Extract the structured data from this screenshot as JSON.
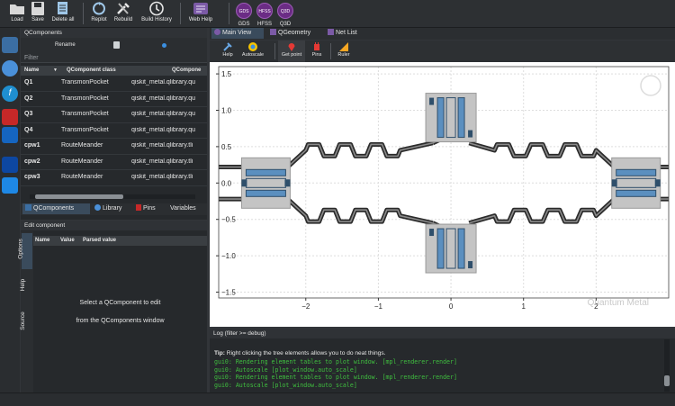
{
  "toolbar": {
    "buttons": [
      {
        "label": "Load",
        "icon": "folder-icon"
      },
      {
        "label": "Save",
        "icon": "save-icon"
      },
      {
        "label": "Delete all",
        "icon": "delete-all-icon"
      },
      {
        "label": "Replot",
        "icon": "replot-icon"
      },
      {
        "label": "Rebuild",
        "icon": "rebuild-icon"
      },
      {
        "label": "Build History",
        "icon": "build-history-icon"
      },
      {
        "label": "Web Help",
        "icon": "web-help-icon"
      }
    ],
    "gds_buttons": [
      {
        "badge": "GDS",
        "label": "GDS"
      },
      {
        "badge": "HFSS",
        "label": "HFSS"
      },
      {
        "badge": "Q3D",
        "label": "Q3D"
      }
    ]
  },
  "qcomponents": {
    "title": "QComponents",
    "rename_label": "Rename",
    "filter_placeholder": "Filter",
    "columns": [
      "Name",
      "QComponent class",
      "QCompone"
    ],
    "rows": [
      {
        "name": "Q1",
        "cls": "TransmonPocket",
        "mod": "qiskit_metal.qlibrary.qu"
      },
      {
        "name": "Q2",
        "cls": "TransmonPocket",
        "mod": "qiskit_metal.qlibrary.qu"
      },
      {
        "name": "Q3",
        "cls": "TransmonPocket",
        "mod": "qiskit_metal.qlibrary.qu"
      },
      {
        "name": "Q4",
        "cls": "TransmonPocket",
        "mod": "qiskit_metal.qlibrary.qu"
      },
      {
        "name": "cpw1",
        "cls": "RouteMeander",
        "mod": "qiskit_metal.qlibrary.tli"
      },
      {
        "name": "cpw2",
        "cls": "RouteMeander",
        "mod": "qiskit_metal.qlibrary.tli"
      },
      {
        "name": "cpw3",
        "cls": "RouteMeander",
        "mod": "qiskit_metal.qlibrary.tli"
      }
    ],
    "tabs": [
      "QComponents",
      "Library",
      "Pins",
      "Variables"
    ]
  },
  "edit": {
    "title": "Edit component",
    "columns": [
      "Name",
      "Value",
      "Parsed value"
    ],
    "message_line1": "Select a QComponent to edit",
    "message_line2": "from the QComponents window",
    "side_tabs": [
      "Options",
      "Help",
      "Source"
    ]
  },
  "main": {
    "tabs": [
      "Main View",
      "QGeometry",
      "Net List"
    ],
    "tools": [
      "Help",
      "Autoscale",
      "Get point",
      "Pins",
      "Ruler"
    ],
    "watermark": "Quantum Metal"
  },
  "chart_data": {
    "type": "scatter",
    "title": "",
    "xlabel": "",
    "ylabel": "",
    "xlim": [
      -3.2,
      3.0
    ],
    "ylim": [
      -1.58,
      1.6
    ],
    "xticks": [
      "−2",
      "−1",
      "0",
      "1",
      "2"
    ],
    "yticks": [
      "1.5",
      "1.0",
      "0.5",
      "0.0",
      "−0.5",
      "−1.0",
      "−1.5"
    ],
    "grid": true,
    "components": [
      {
        "name": "Q1",
        "x": -2.55,
        "y": 0.0,
        "orientation": "horizontal"
      },
      {
        "name": "Q2",
        "x": 0.0,
        "y": 0.9,
        "orientation": "vertical"
      },
      {
        "name": "Q3",
        "x": 2.55,
        "y": 0.0,
        "orientation": "horizontal"
      },
      {
        "name": "Q4",
        "x": 0.0,
        "y": -0.9,
        "orientation": "vertical"
      }
    ]
  },
  "log": {
    "title": "Log  (filter >= debug)",
    "tip_bold": "Tip:",
    "tip_text": " Right clicking the tree elements allows you to do neat things.",
    "lines": [
      "gui0: Rendering element tables to plot window. [mpl_renderer.render]",
      "gui0: Autoscale [plot_window.auto_scale]",
      "gui0: Rendering element tables to plot window. [mpl_renderer.render]",
      "gui0: Autoscale [plot_window.auto_scale]"
    ]
  },
  "colors": {
    "accent": "#3a4b5c",
    "gds": "#6b2c85",
    "log_text": "#3fbf3f",
    "qubit_pad": "#5b8fbf"
  }
}
